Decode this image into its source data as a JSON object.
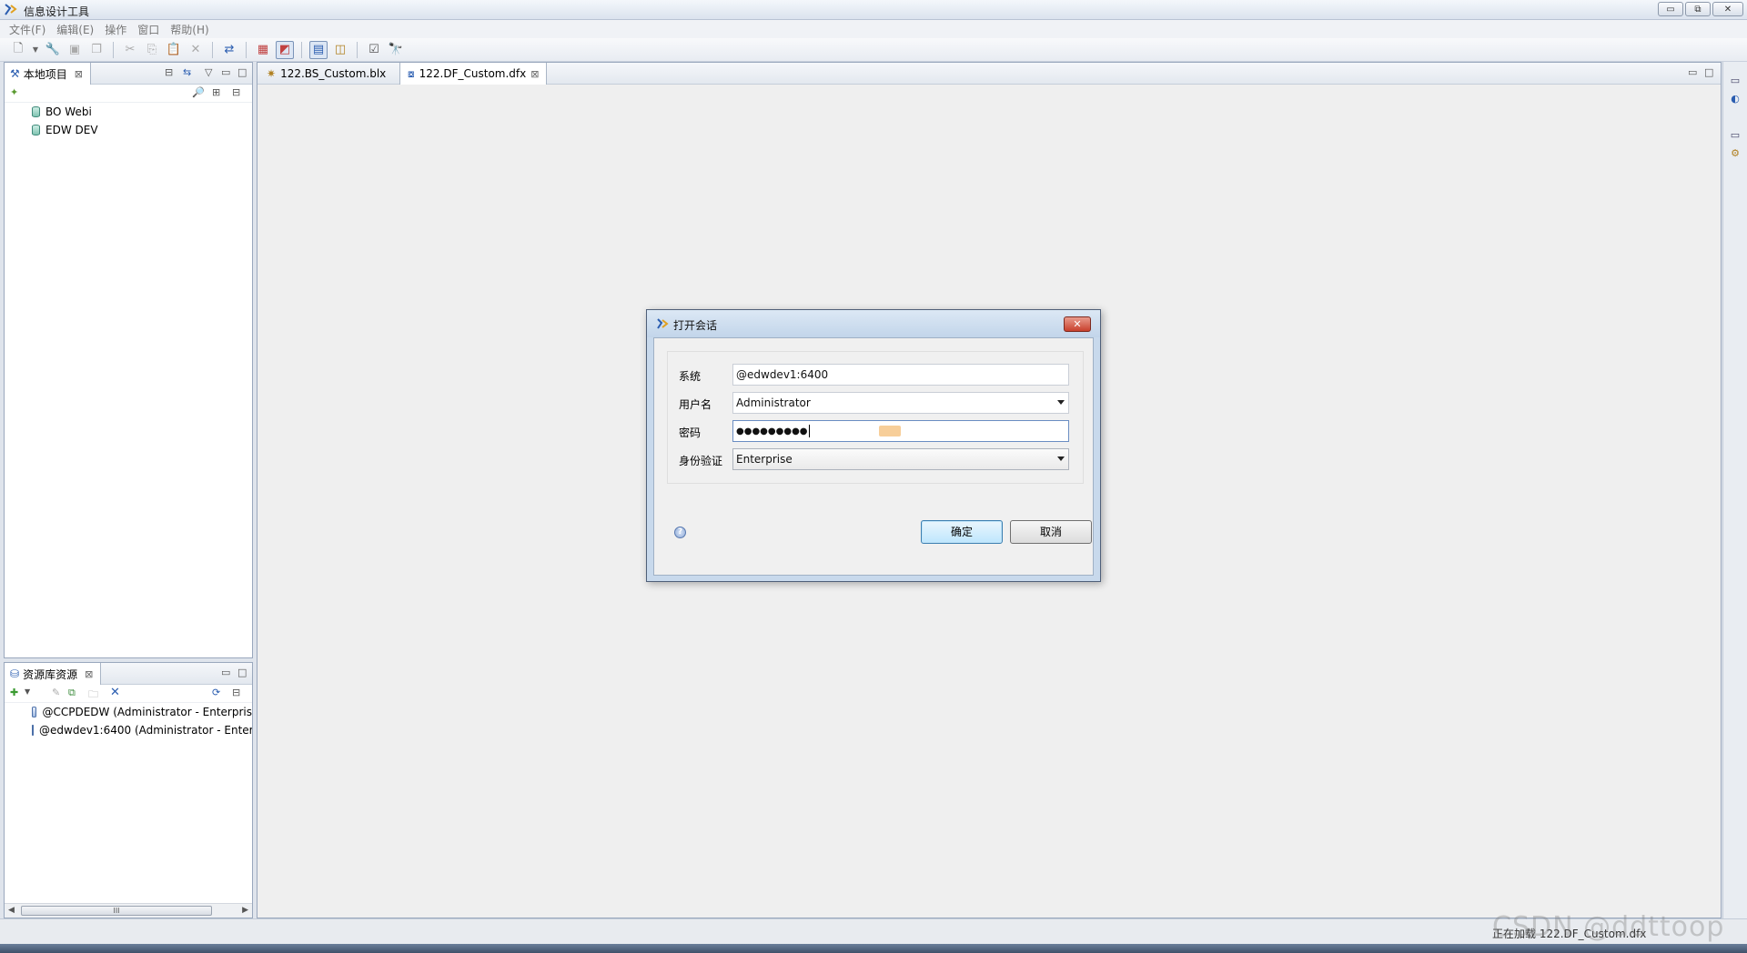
{
  "window": {
    "title": "信息设计工具",
    "min": "▭",
    "max": "⧉",
    "close": "✕"
  },
  "menu": [
    "文件(F)",
    "编辑(E)",
    "操作",
    "窗口",
    "帮助(H)"
  ],
  "toolbar": {
    "icons": [
      "new-icon",
      "dropdown-icon",
      "key-icon",
      "save-icon",
      "save-all-icon",
      "cut-icon",
      "copy-icon",
      "paste-icon",
      "delete-icon",
      "publish-icon",
      "resource-icon",
      "query-icon",
      "layout-icon",
      "data-icon",
      "check-icon",
      "binoculars-icon"
    ]
  },
  "local_projects": {
    "tab_label": "本地项目",
    "items": [
      "BO Webi",
      "EDW DEV"
    ]
  },
  "repository": {
    "tab_label": "资源库资源",
    "items": [
      "@CCPDEDW (Administrator - Enterpris",
      "@edwdev1:6400 (Administrator - Enter"
    ],
    "scroll_thumb": "III"
  },
  "editor": {
    "tabs": [
      {
        "label": "122.BS_Custom.blx",
        "active": false
      },
      {
        "label": "122.DF_Custom.dfx",
        "active": true
      }
    ]
  },
  "dialog": {
    "title": "打开会话",
    "close": "✕",
    "fields": {
      "system_label": "系统",
      "system_value": "@edwdev1:6400",
      "user_label": "用户名",
      "user_value": "Administrator",
      "password_label": "密码",
      "password_value": "●●●●●●●●●",
      "auth_label": "身份验证",
      "auth_value": "Enterprise"
    },
    "help": "?",
    "ok": "确定",
    "cancel": "取消"
  },
  "status": {
    "text": "正在加载 122.DF_Custom.dfx"
  },
  "watermark": "CSDN @ddttoop"
}
